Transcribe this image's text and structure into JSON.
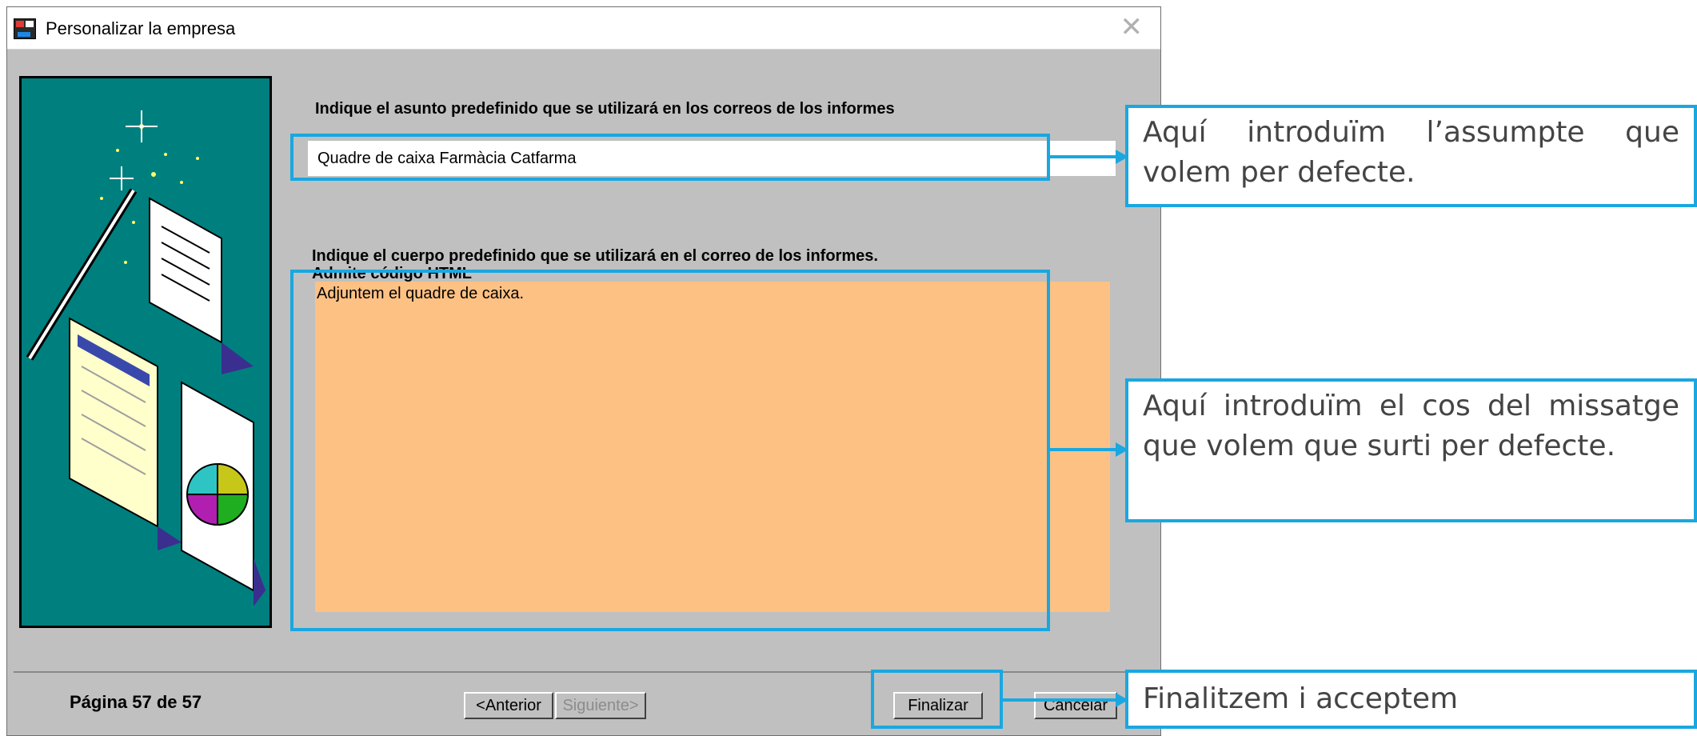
{
  "window": {
    "title": "Personalizar la empresa",
    "close_symbol": "✕"
  },
  "wizard": {
    "subject_label": "Indique el asunto predefinido que se utilizará en los correos de los informes",
    "subject_value": "Quadre de caixa Farmàcia Catfarma",
    "body_label_line1": "Indique el cuerpo predefinido que se utilizará en el correo de los informes.",
    "body_label_line2": "Admite código HTML",
    "body_value": "Adjuntem el quadre de caixa."
  },
  "footer": {
    "page_label": "Página 57 de 57",
    "prev_button": "<Anterior",
    "next_button": "Siguiente>",
    "finish_button": "Finalizar",
    "cancel_button": "Cancelar"
  },
  "annotations": {
    "subject_note": "Aquí introduïm l’assumpte que volem per defecte.",
    "body_note": "Aquí introduïm el cos del missatge que volem que surti per defecte.",
    "finish_note": "Finalitzem i acceptem"
  },
  "colors": {
    "dialog_bg": "#c0c0c0",
    "art_bg": "#007f7f",
    "body_field_bg": "#fec184",
    "callout_blue": "#1aa7e0"
  },
  "icons": {
    "app": "app-icon",
    "close": "close-icon",
    "wizard_art": "wizard-illustration"
  }
}
